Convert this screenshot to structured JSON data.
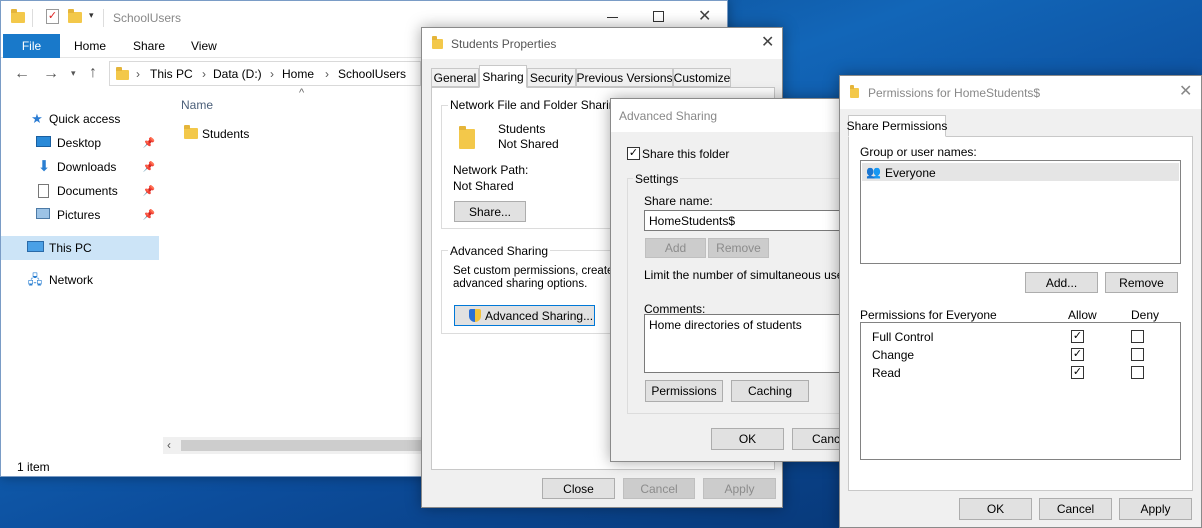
{
  "explorer": {
    "title": "SchoolUsers",
    "ribbon_tabs": [
      "File",
      "Home",
      "Share",
      "View"
    ],
    "breadcrumb": [
      "This PC",
      "Data (D:)",
      "Home",
      "SchoolUsers"
    ],
    "nav": {
      "quick_access": "Quick access",
      "desktop": "Desktop",
      "downloads": "Downloads",
      "documents": "Documents",
      "pictures": "Pictures",
      "this_pc": "This PC",
      "network": "Network"
    },
    "column_name": "Name",
    "files": [
      "Students"
    ],
    "status": "1 item"
  },
  "properties": {
    "title": "Students Properties",
    "tabs": [
      "General",
      "Sharing",
      "Security",
      "Previous Versions",
      "Customize"
    ],
    "nffs_title": "Network File and Folder Sharing",
    "folder_name": "Students",
    "folder_state": "Not Shared",
    "network_path_label": "Network Path:",
    "network_path_value": "Not Shared",
    "share_button": "Share...",
    "adv_title": "Advanced Sharing",
    "adv_desc_1": "Set custom permissions, create mu",
    "adv_desc_2": "advanced sharing options.",
    "adv_button": "Advanced Sharing...",
    "close": "Close",
    "cancel": "Cancel",
    "apply": "Apply"
  },
  "advanced": {
    "title": "Advanced Sharing",
    "share_folder_label": "Share this folder",
    "settings_title": "Settings",
    "share_name_label": "Share name:",
    "share_name_value": "HomeStudents$",
    "add": "Add",
    "remove": "Remove",
    "limit_text": "Limit the number of simultaneous users to",
    "comments_label": "Comments:",
    "comments_value": "Home directories of students",
    "permissions": "Permissions",
    "caching": "Caching",
    "ok": "OK",
    "cancel": "Cance"
  },
  "permissions": {
    "title": "Permissions for HomeStudents$",
    "tab": "Share Permissions",
    "group_label": "Group or user names:",
    "users": [
      "Everyone"
    ],
    "add": "Add...",
    "remove": "Remove",
    "perm_header": "Permissions for Everyone",
    "allow": "Allow",
    "deny": "Deny",
    "rows": [
      {
        "name": "Full Control",
        "allow": true,
        "deny": false
      },
      {
        "name": "Change",
        "allow": true,
        "deny": false
      },
      {
        "name": "Read",
        "allow": true,
        "deny": false
      }
    ],
    "ok": "OK",
    "cancel": "Cancel",
    "apply": "Apply"
  }
}
